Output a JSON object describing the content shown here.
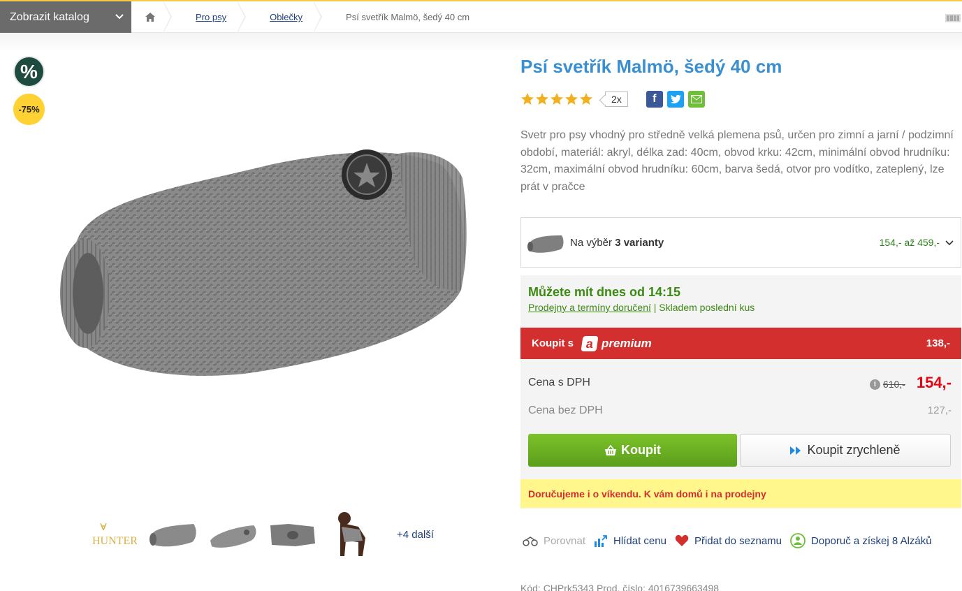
{
  "topbar": {
    "catalog_label": "Zobrazit katalog",
    "breadcrumbs": [
      {
        "label": "Pro psy"
      },
      {
        "label": "Oblečky"
      }
    ],
    "current": "Psí svetřík Malmö, šedý 40 cm"
  },
  "badges": {
    "percent": "%",
    "discount": "-75%"
  },
  "gallery": {
    "brand_thumb": "HUNTER",
    "more_label": "+4 další"
  },
  "product": {
    "title": "Psí svetřík Malmö, šedý 40 cm",
    "rating_stars": 5,
    "review_count": "2x",
    "description": "Svetr pro psy vhodný pro středně velká plemena psů, určen pro zimní a jarní / podzimní období, materiál: akryl, délka zad: 40cm, obvod krku: 42cm, minimální obvod hrudníku: 32cm, maximální obvod hrudníku: 60cm, barva šedá, otvor pro vodítko, zateplený, lze prát v pračce"
  },
  "variants": {
    "prefix": "Na výběr ",
    "count_label": "3 varianty",
    "price_range": "154,- až 459,-"
  },
  "availability": {
    "title": "Můžete mít dnes od 14:15",
    "link": "Prodejny a termíny doručení",
    "separator": " | ",
    "stock": "Skladem poslední kus"
  },
  "premium": {
    "label": "Koupit s",
    "logo_letter": "a",
    "logo_text": "premium",
    "price": "138,-"
  },
  "pricing": {
    "vat_label": "Cena s DPH",
    "info": "i",
    "old_price": "610,-",
    "price": "154,-",
    "net_label": "Cena bez DPH",
    "net_price": "127,-"
  },
  "buttons": {
    "buy": "Koupit",
    "buy_fast": "Koupit zrychleně"
  },
  "notice": "Doručujeme i o víkendu. K vám domů i na prodejny",
  "actions": {
    "compare": "Porovnat",
    "watch_price": "Hlídat cenu",
    "add_list": "Přidat do seznamu",
    "recommend": "Doporuč a získej 8 Alzáků"
  },
  "codes": "Kód: CHPrk5343   Prod. číslo: 4016739663498",
  "colors": {
    "title_blue": "#3a8fd0",
    "buy_green": "#5a9e1b",
    "premium_red": "#d32f2f",
    "price_red": "#e30613",
    "notice_yellow": "#fff78c",
    "availability_green": "#3c8a12"
  }
}
